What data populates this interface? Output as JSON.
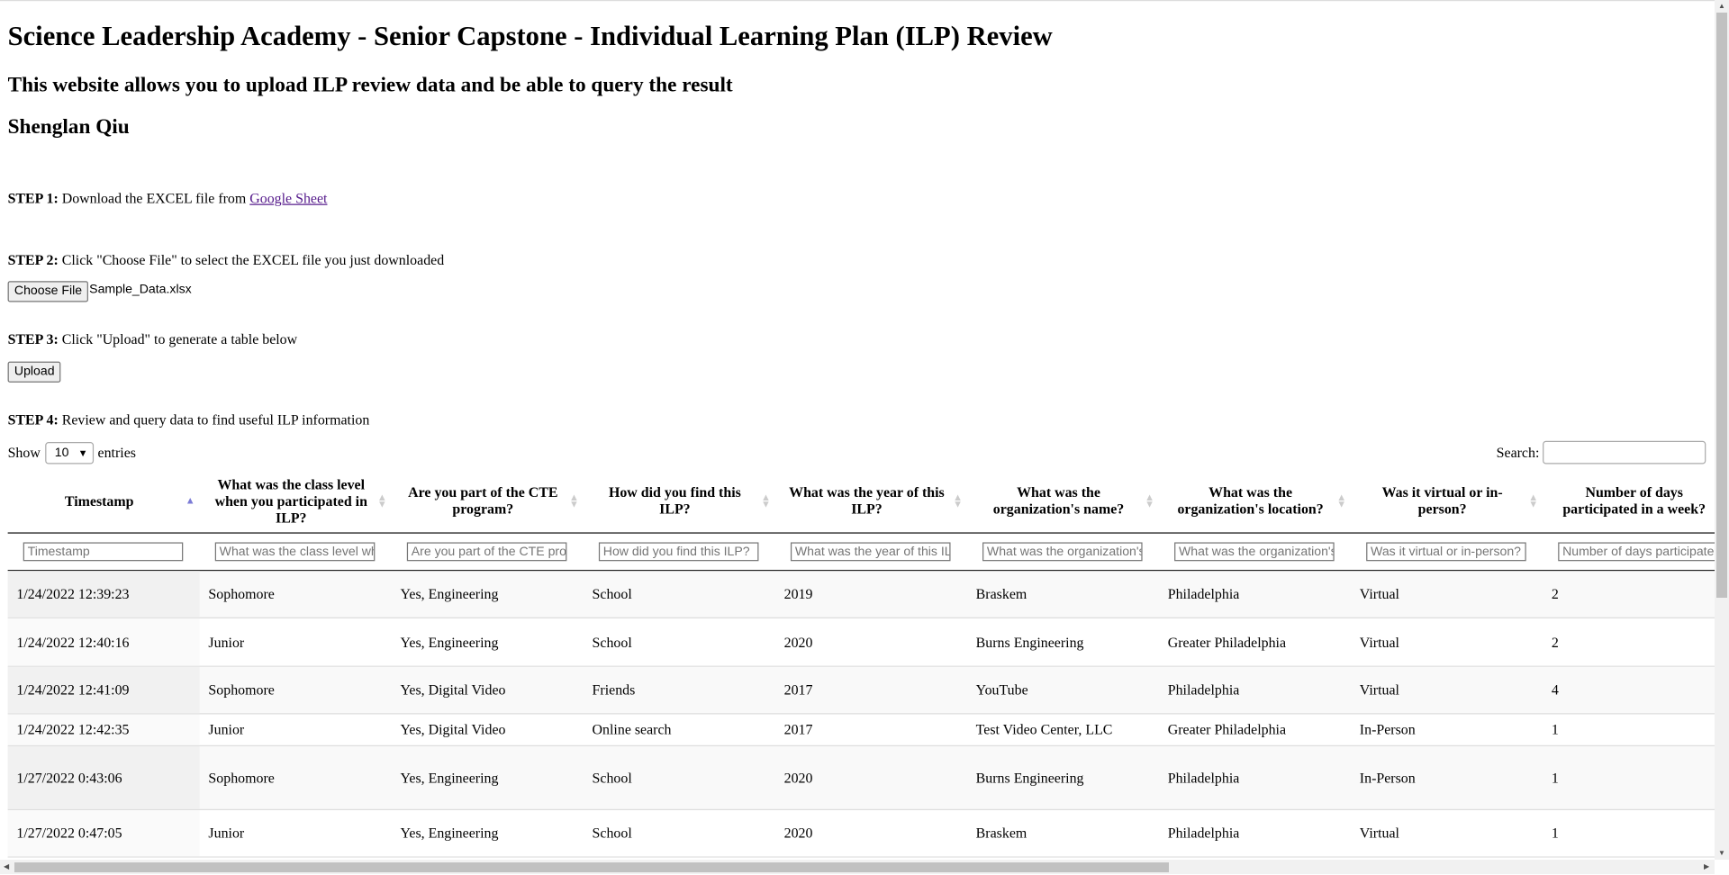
{
  "title": "Science Leadership Academy - Senior Capstone - Individual Learning Plan (ILP) Review",
  "subtitle": "This website allows you to upload ILP review data and be able to query the result",
  "author": "Shenglan Qiu",
  "steps": [
    {
      "label": "STEP 1:",
      "text": "Download the EXCEL file from ",
      "link": "Google Sheet"
    },
    {
      "label": "STEP 2:",
      "text": "Click \"Choose File\" to select the EXCEL file you just downloaded"
    },
    {
      "label": "STEP 3:",
      "text": "Click \"Upload\" to generate a table below"
    },
    {
      "label": "STEP 4:",
      "text": "Review and query data to find useful ILP information"
    }
  ],
  "file": {
    "button": "Choose File",
    "name": "Sample_Data.xlsx"
  },
  "upload_label": "Upload",
  "length": {
    "show": "Show",
    "value": "10",
    "entries": "entries"
  },
  "search": {
    "label": "Search:",
    "value": ""
  },
  "columns": [
    "Timestamp",
    "What was the class level when you participated in ILP?",
    "Are you part of the CTE program?",
    "How did you find this ILP?",
    "What was the year of this ILP?",
    "What was the organization's name?",
    "What was the organization's location?",
    "Was it virtual or in-person?",
    "Number of days participated in a week?"
  ],
  "filters": [
    "Timestamp",
    "What was the class level when you participated in ILP?",
    "Are you part of the CTE program?",
    "How did you find this ILP?",
    "What was the year of this ILP?",
    "What was the organization's name?",
    "What was the organization's location?",
    "Was it virtual or in-person?",
    "Number of days participated in a week?"
  ],
  "sort": {
    "column": "Timestamp",
    "direction": "ascending"
  },
  "rows": [
    [
      "1/24/2022 12:39:23",
      "Sophomore",
      "Yes, Engineering",
      "School",
      "2019",
      "Braskem",
      "Philadelphia",
      "Virtual",
      "2"
    ],
    [
      "1/24/2022 12:40:16",
      "Junior",
      "Yes, Engineering",
      "School",
      "2020",
      "Burns Engineering",
      "Greater Philadelphia",
      "Virtual",
      "2"
    ],
    [
      "1/24/2022 12:41:09",
      "Sophomore",
      "Yes, Digital Video",
      "Friends",
      "2017",
      "YouTube",
      "Philadelphia",
      "Virtual",
      "4"
    ],
    [
      "1/24/2022 12:42:35",
      "Junior",
      "Yes, Digital Video",
      "Online search",
      "2017",
      "Test Video Center, LLC",
      "Greater Philadelphia",
      "In-Person",
      "1"
    ],
    [
      "1/27/2022 0:43:06",
      "Sophomore",
      "Yes, Engineering",
      "School",
      "2020",
      "Burns Engineering",
      "Philadelphia",
      "In-Person",
      "1"
    ],
    [
      "1/27/2022 0:47:05",
      "Junior",
      "Yes, Engineering",
      "School",
      "2020",
      "Braskem",
      "Philadelphia",
      "Virtual",
      "1"
    ]
  ]
}
